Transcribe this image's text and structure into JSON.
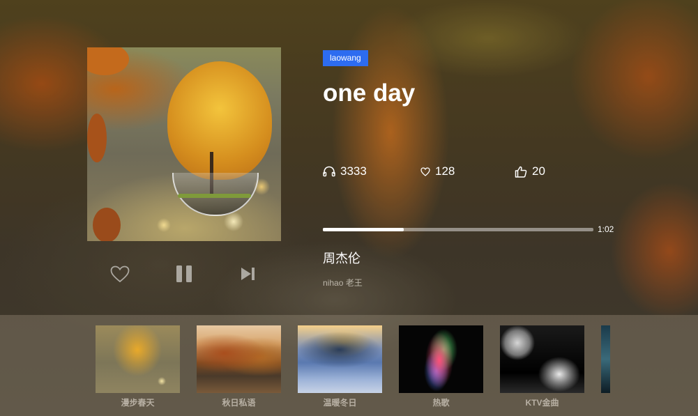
{
  "player": {
    "tag": "laowang",
    "title": "one day",
    "stats": {
      "listens": "3333",
      "favorites": "128",
      "likes": "20"
    },
    "progress_percent": 30,
    "time": "1:02",
    "artist": "周杰伦",
    "description": "nihao 老王"
  },
  "controls": {
    "favorite_icon": "heart-icon",
    "pause_icon": "pause-icon",
    "next_icon": "skip-next-icon"
  },
  "playlists": [
    {
      "label": "漫步春天"
    },
    {
      "label": "秋日私语"
    },
    {
      "label": "温暖冬日"
    },
    {
      "label": "热歌"
    },
    {
      "label": "KTV金曲"
    }
  ],
  "colors": {
    "tag_background": "#2d6cf0",
    "text": "#ffffff",
    "muted_text": "#bdb7aa"
  }
}
